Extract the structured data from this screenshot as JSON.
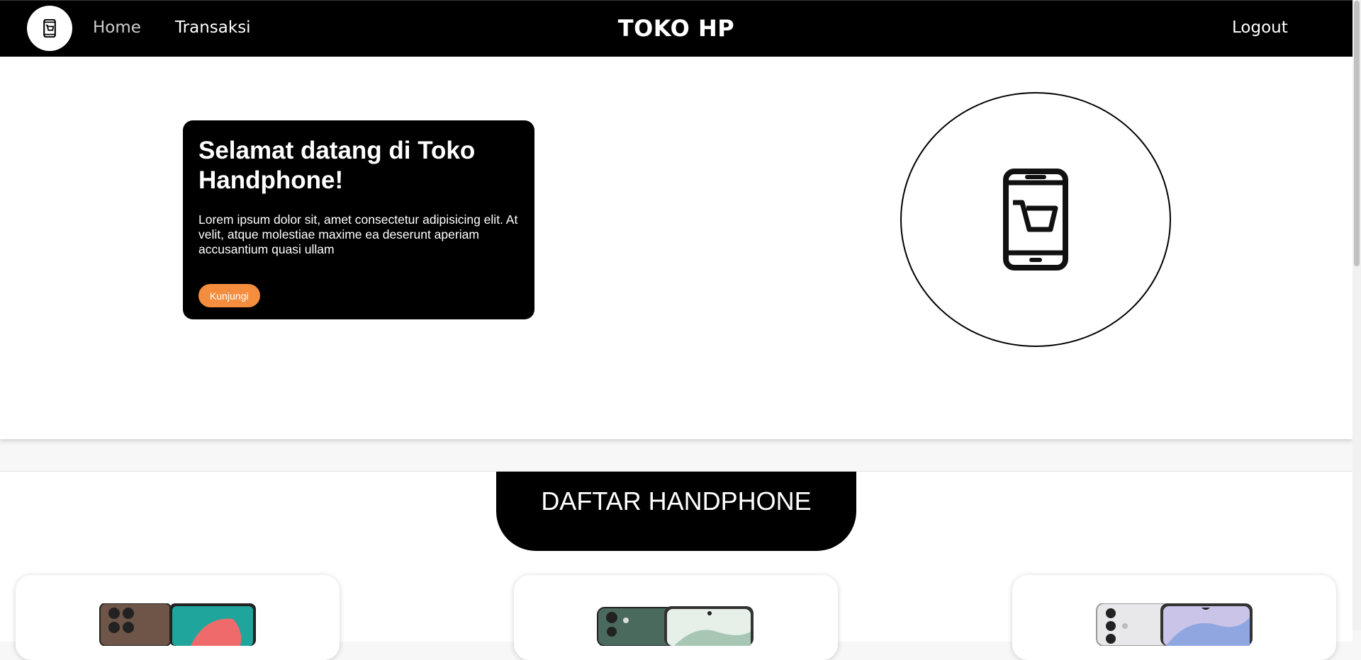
{
  "nav": {
    "home": "Home",
    "transaksi": "Transaksi",
    "brand": "TOKO HP",
    "logout": "Logout",
    "logo_icon": "phone-cart-icon"
  },
  "hero": {
    "title": "Selamat datang di Toko Handphone!",
    "text": "Lorem ipsum dolor sit, amet consectetur adipisicing elit. At velit, atque molestiae maxime ea deserunt aperiam accusantium quasi ullam",
    "button": "Kunjungi",
    "button_color": "#f48e3e",
    "illustration_icon": "phone-cart-icon"
  },
  "section": {
    "title": "DAFTAR HANDPHONE"
  },
  "products": [
    {
      "image": "phone-brown"
    },
    {
      "image": "phone-green"
    },
    {
      "image": "phone-silver"
    }
  ]
}
